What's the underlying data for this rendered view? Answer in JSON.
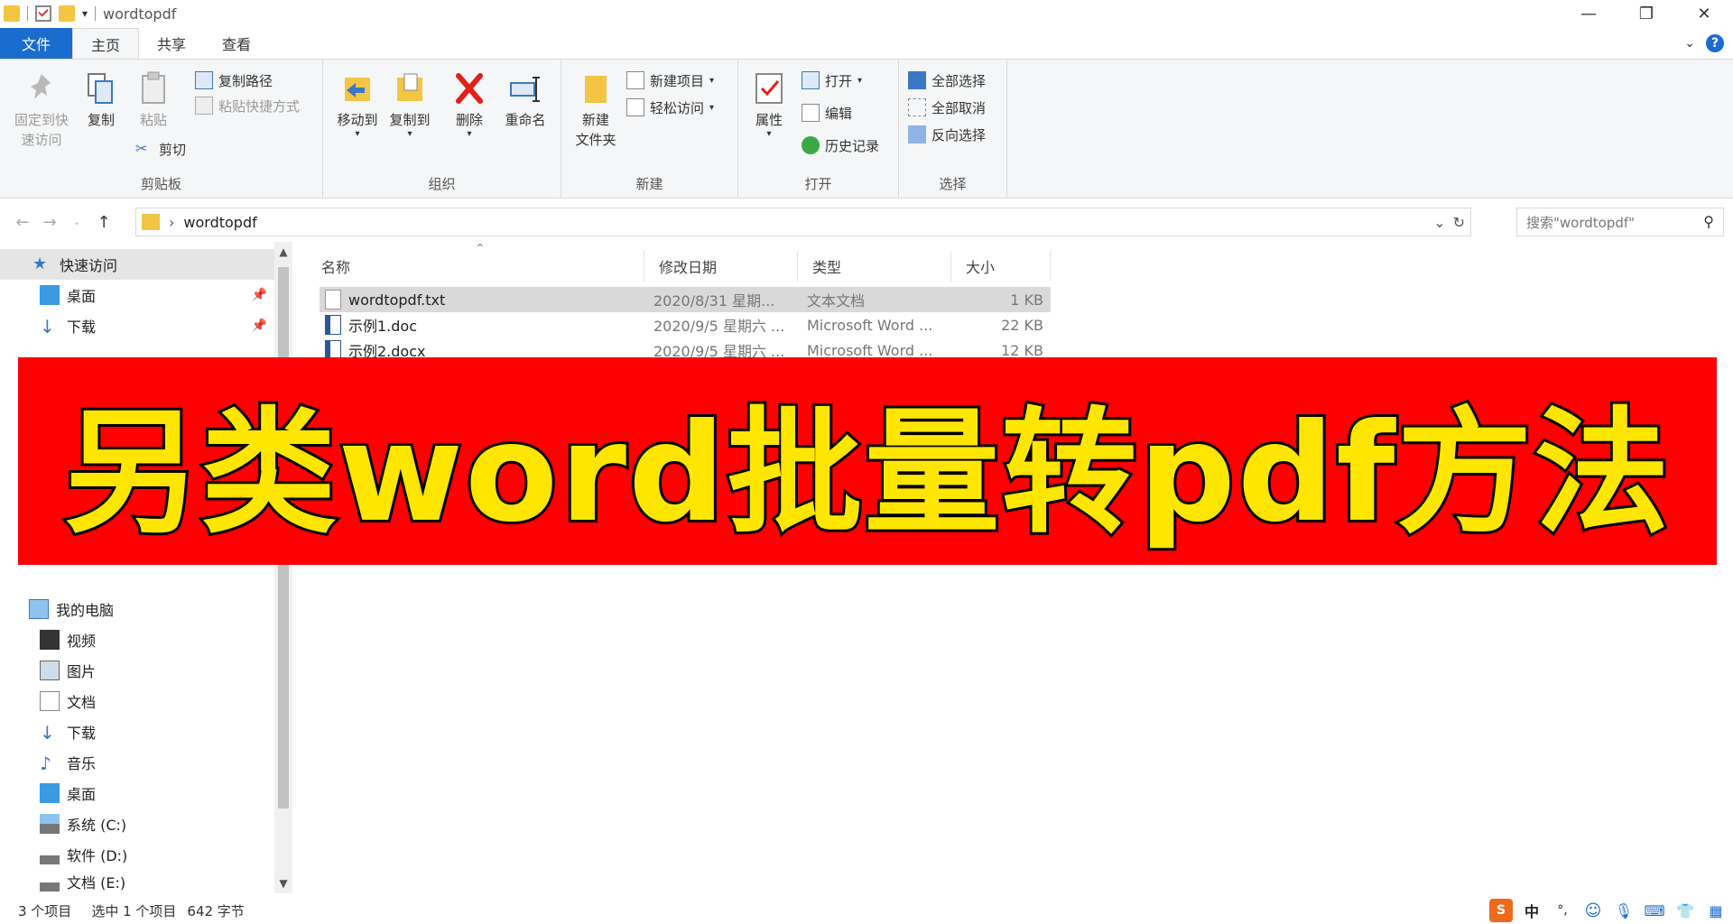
{
  "window": {
    "title": "wordtopdf"
  },
  "tabs": [
    {
      "label": "文件"
    },
    {
      "label": "主页"
    },
    {
      "label": "共享"
    },
    {
      "label": "查看"
    }
  ],
  "ribbon": {
    "clipboard": {
      "label": "剪贴板",
      "pin": "固定到快\n速访问",
      "pin_line1": "固定到快",
      "pin_line2": "速访问",
      "copy": "复制",
      "paste": "粘贴",
      "copy_path": "复制路径",
      "paste_shortcut": "粘贴快捷方式",
      "cut": "剪切"
    },
    "organize": {
      "label": "组织",
      "move_to": "移动到",
      "copy_to": "复制到",
      "delete": "删除",
      "rename": "重命名"
    },
    "new": {
      "label": "新建",
      "new_folder_line1": "新建",
      "new_folder_line2": "文件夹",
      "new_item": "新建项目",
      "easy_access": "轻松访问"
    },
    "open": {
      "label": "打开",
      "properties": "属性",
      "open": "打开",
      "edit": "编辑",
      "history": "历史记录"
    },
    "select": {
      "label": "选择",
      "select_all": "全部选择",
      "select_none": "全部取消",
      "invert": "反向选择"
    }
  },
  "address": {
    "path": "wordtopdf",
    "search_placeholder": "搜索\"wordtopdf\""
  },
  "nav": {
    "quick_access": "快速访问",
    "desktop": "桌面",
    "downloads": "下载",
    "this_pc": "我的电脑",
    "videos": "视频",
    "pictures": "图片",
    "documents": "文档",
    "downloads2": "下载",
    "music": "音乐",
    "desktop2": "桌面",
    "drive_c": "系统 (C:)",
    "drive_d": "软件 (D:)",
    "drive_e": "文档 (E:)"
  },
  "columns": {
    "name": "名称",
    "date": "修改日期",
    "type": "类型",
    "size": "大小"
  },
  "files": [
    {
      "name": "wordtopdf.txt",
      "date": "2020/8/31 星期...",
      "type": "文本文档",
      "size": "1 KB"
    },
    {
      "name": "示例1.doc",
      "date": "2020/9/5 星期六 ...",
      "type": "Microsoft Word ...",
      "size": "22 KB"
    },
    {
      "name": "示例2.docx",
      "date": "2020/9/5 星期六 ...",
      "type": "Microsoft Word ...",
      "size": "12 KB"
    }
  ],
  "banner": {
    "text": "另类word批量转pdf方法"
  },
  "status": {
    "count": "3 个项目",
    "selected": "选中 1 个项目",
    "size": "642 字节"
  },
  "tray": {
    "ime": "中"
  },
  "colors": {
    "accent": "#1a6ccf",
    "banner_bg": "#ff0000",
    "banner_text": "#ffe600"
  }
}
